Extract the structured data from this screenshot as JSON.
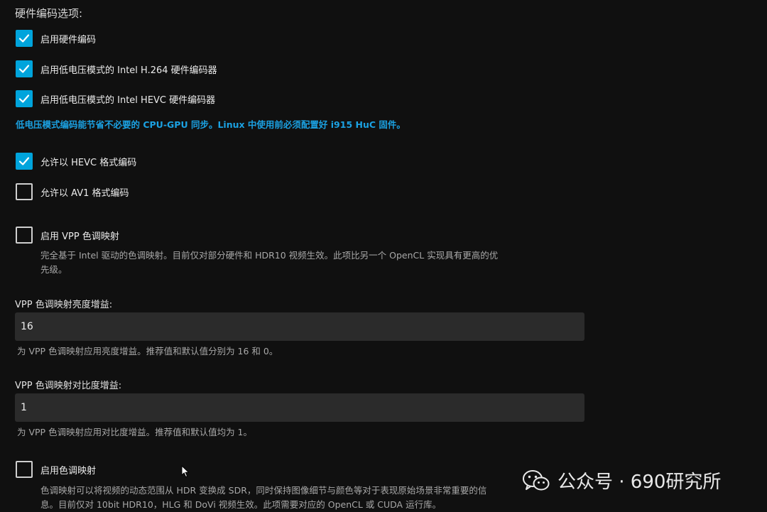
{
  "section": {
    "title": "硬件编码选项:"
  },
  "encoding_options": [
    {
      "label": "启用硬件编码",
      "checked": true
    },
    {
      "label": "启用低电压模式的 Intel H.264 硬件编码器",
      "checked": true
    },
    {
      "label": "启用低电压模式的 Intel HEVC 硬件编码器",
      "checked": true
    }
  ],
  "low_power_note": "低电压模式编码能节省不必要的 CPU-GPU 同步。Linux 中使用前必须配置好 i915 HuC 固件。",
  "format_options": [
    {
      "label": "允许以 HEVC 格式编码",
      "checked": true
    },
    {
      "label": "允许以 AV1 格式编码",
      "checked": false
    }
  ],
  "vpp_tonemap": {
    "label": "启用 VPP 色调映射",
    "checked": false,
    "help_line1": "完全基于 Intel 驱动的色调映射。目前仅对部分硬件和 HDR10 视频生效。此项比另一个 OpenCL 实现具有更高的优",
    "help_line2": "先级。"
  },
  "vpp_brightness": {
    "label": "VPP 色调映射亮度增益:",
    "value": "16",
    "help": "为 VPP 色调映射应用亮度增益。推荐值和默认值分别为 16 和 0。"
  },
  "vpp_contrast": {
    "label": "VPP 色调映射对比度增益:",
    "value": "1",
    "help": "为 VPP 色调映射应用对比度增益。推荐值和默认值均为 1。"
  },
  "tonemap": {
    "label": "启用色调映射",
    "checked": false,
    "help_line1": "色调映射可以将视频的动态范围从 HDR 变换成 SDR，同时保持图像细节与颜色等对于表现原始场景非常重要的信",
    "help_line2": "息。目前仅对 10bit HDR10，HLG 和 DoVi 视频生效。此项需要对应的 OpenCL 或 CUDA 运行库。"
  },
  "watermark": {
    "text": "公众号 · 690研究所",
    "icon": "wechat-icon"
  },
  "colors": {
    "accent": "#00a4dc",
    "note": "#1ba1e2",
    "background": "#101010"
  }
}
